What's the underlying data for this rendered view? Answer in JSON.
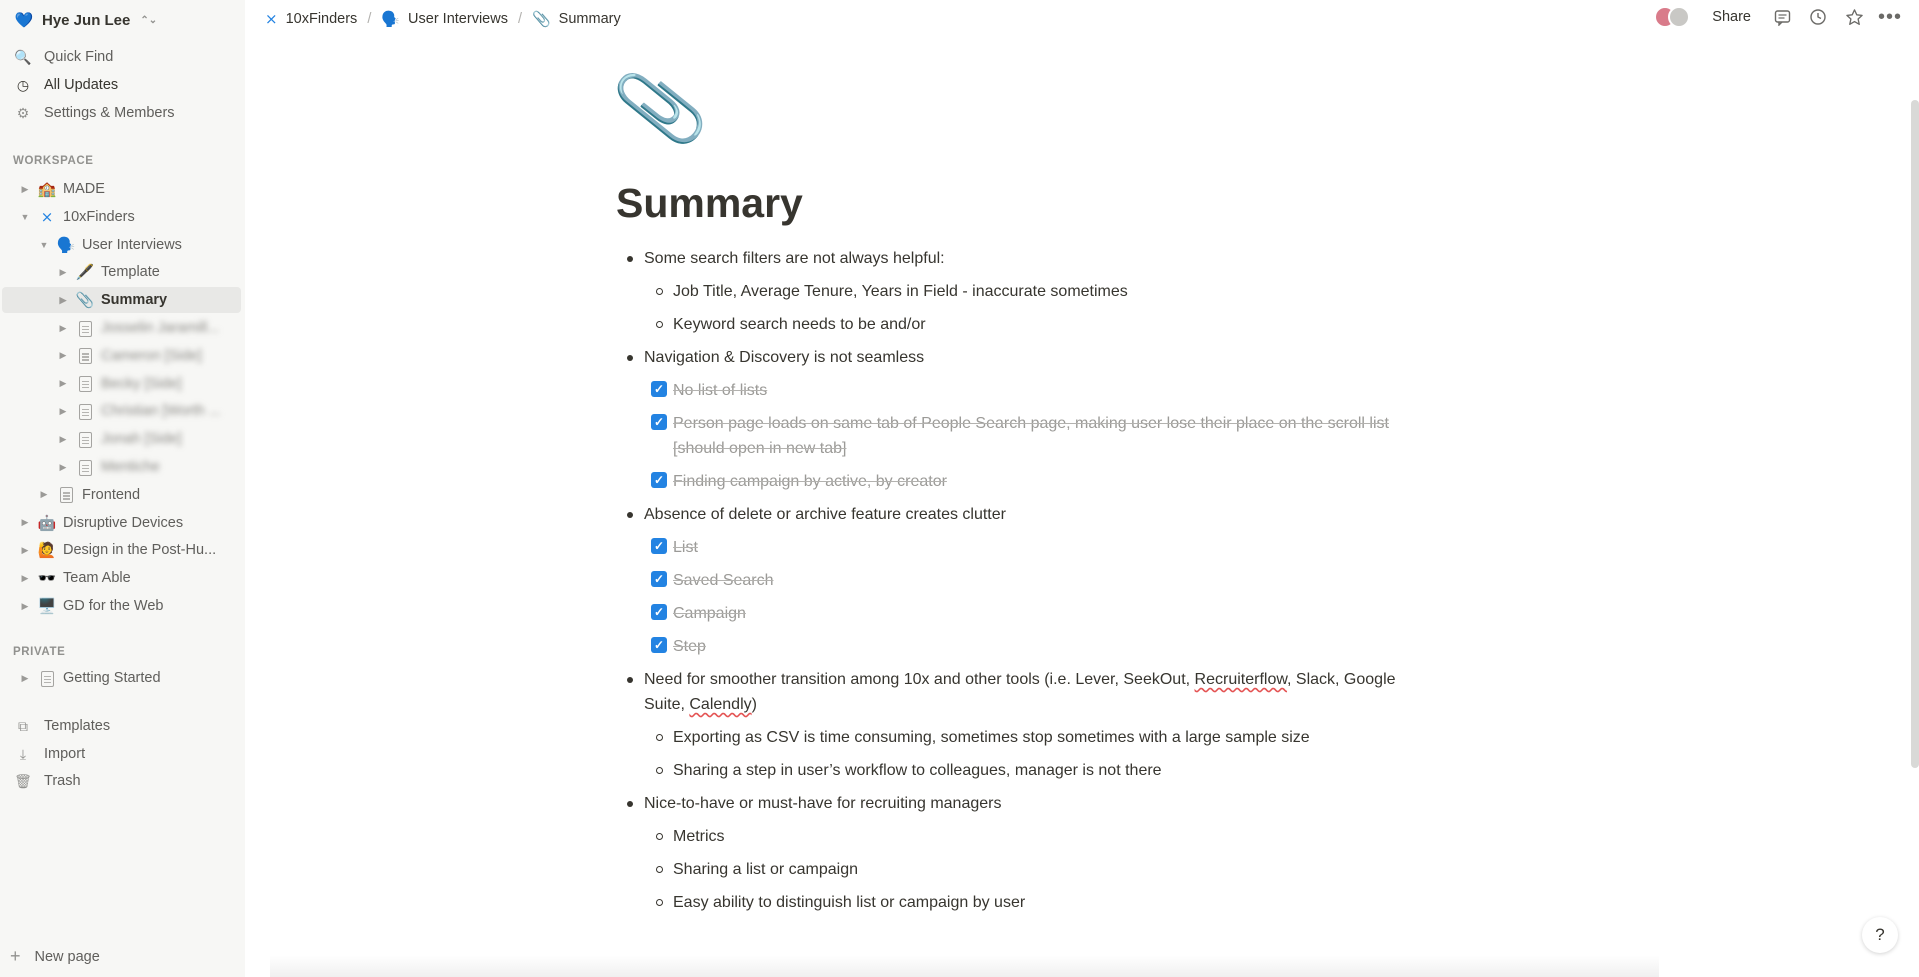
{
  "workspace": {
    "name": "Hye Jun Lee",
    "icon": "💙"
  },
  "sidebar": {
    "top": [
      {
        "icon": "🔍",
        "label": "Quick Find"
      },
      {
        "icon": "◷",
        "label": "All Updates"
      },
      {
        "icon": "⚙",
        "label": "Settings & Members"
      }
    ],
    "workspace_label": "WORKSPACE",
    "tree": [
      {
        "label": "MADE",
        "icon": "🏫",
        "indent": 0,
        "caret": "▶"
      },
      {
        "label": "10xFinders",
        "icon": "⨯",
        "indent": 0,
        "caret": "▼"
      },
      {
        "label": "User Interviews",
        "icon": "🗣️",
        "indent": 1,
        "caret": "▼"
      },
      {
        "label": "Template",
        "icon": "🖋️",
        "indent": 2,
        "caret": "▶"
      },
      {
        "label": "Summary",
        "icon": "📎",
        "indent": 2,
        "caret": "▶",
        "active": true
      },
      {
        "label": "Josselin Jaramill...",
        "icon": "doc",
        "indent": 2,
        "caret": "▶",
        "blur": true
      },
      {
        "label": "Cameron [Side]",
        "icon": "doc",
        "indent": 2,
        "caret": "▶",
        "blur": true
      },
      {
        "label": "Becky [Side]",
        "icon": "doc",
        "indent": 2,
        "caret": "▶",
        "blur": true
      },
      {
        "label": "Christian [Worth ...",
        "icon": "doc",
        "indent": 2,
        "caret": "▶",
        "blur": true
      },
      {
        "label": "Jonah [Side]",
        "icon": "doc",
        "indent": 2,
        "caret": "▶",
        "blur": true
      },
      {
        "label": "Mentiche",
        "icon": "doc",
        "indent": 2,
        "caret": "▶",
        "blur": true
      },
      {
        "label": "Frontend",
        "icon": "doc",
        "indent": 1,
        "caret": "▶"
      },
      {
        "label": "Disruptive Devices",
        "icon": "🤖",
        "indent": 0,
        "caret": "▶"
      },
      {
        "label": "Design in the Post-Hu...",
        "icon": "🙋",
        "indent": 0,
        "caret": "▶"
      },
      {
        "label": "Team Able",
        "icon": "🕶️",
        "indent": 0,
        "caret": "▶"
      },
      {
        "label": "GD for the Web",
        "icon": "🖥️",
        "indent": 0,
        "caret": "▶"
      }
    ],
    "private_label": "PRIVATE",
    "private": [
      {
        "label": "Getting Started",
        "icon": "doc",
        "caret": "▶"
      }
    ],
    "bottom": [
      {
        "icon": "⧉",
        "label": "Templates"
      },
      {
        "icon": "⤓",
        "label": "Import"
      },
      {
        "icon": "🗑",
        "label": "Trash"
      }
    ],
    "new_page": "New page"
  },
  "breadcrumb": [
    {
      "icon": "⨯",
      "label": "10xFinders"
    },
    {
      "icon": "🗣️",
      "label": "User Interviews"
    },
    {
      "icon": "📎",
      "label": "Summary"
    }
  ],
  "topbar": {
    "share": "Share"
  },
  "page": {
    "icon": "📎",
    "title": "Summary",
    "blocks": [
      {
        "type": "bullet",
        "level": 0,
        "text": "Some search filters are not always helpful:"
      },
      {
        "type": "bullet",
        "level": 1,
        "text": "Job Title, Average Tenure, Years in Field - inaccurate sometimes"
      },
      {
        "type": "bullet",
        "level": 1,
        "text": "Keyword search needs to be and/or"
      },
      {
        "type": "bullet",
        "level": 0,
        "text": "Navigation & Discovery is not seamless"
      },
      {
        "type": "todo",
        "level": 1,
        "checked": true,
        "text": "No list of lists"
      },
      {
        "type": "todo",
        "level": 1,
        "checked": true,
        "text": "Person page loads on same tab of People Search page, making user lose their place on the scroll list [should open in new tab]"
      },
      {
        "type": "todo",
        "level": 1,
        "checked": true,
        "text": "Finding campaign by active, by creator"
      },
      {
        "type": "bullet",
        "level": 0,
        "text": "Absence of delete or archive feature creates clutter"
      },
      {
        "type": "todo",
        "level": 1,
        "checked": true,
        "text": "List"
      },
      {
        "type": "todo",
        "level": 1,
        "checked": true,
        "text": "Saved Search"
      },
      {
        "type": "todo",
        "level": 1,
        "checked": true,
        "text": "Campaign"
      },
      {
        "type": "todo",
        "level": 1,
        "checked": true,
        "text": "Step"
      },
      {
        "type": "bullet",
        "level": 0,
        "text": "Need for smoother transition among 10x and other tools (i.e. Lever, SeekOut, Recruiterflow, Slack, Google Suite, Calendly)"
      },
      {
        "type": "bullet",
        "level": 1,
        "text": "Exporting as CSV is time consuming, sometimes stop sometimes with a large sample size"
      },
      {
        "type": "bullet",
        "level": 1,
        "text": "Sharing a step in user’s workflow to colleagues, manager is not there"
      },
      {
        "type": "bullet",
        "level": 0,
        "text": "Nice-to-have or must-have for recruiting managers"
      },
      {
        "type": "bullet",
        "level": 1,
        "text": "Metrics"
      },
      {
        "type": "bullet",
        "level": 1,
        "text": "Sharing a list or campaign"
      },
      {
        "type": "bullet",
        "level": 1,
        "text": "Easy ability to distinguish list or campaign by user"
      }
    ]
  },
  "help": "?",
  "colors": {
    "accent": "#2383e2",
    "sidebar_bg": "#f7f7f5",
    "text": "#37352f"
  }
}
